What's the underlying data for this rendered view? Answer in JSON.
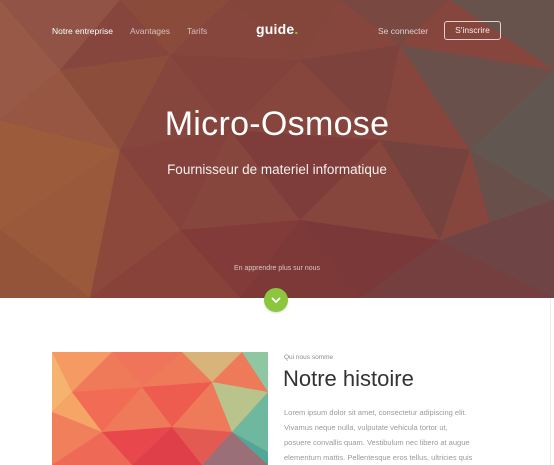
{
  "nav": {
    "links": [
      "Notre entreprise",
      "Avantages",
      "Tarifs"
    ],
    "brand": "guide",
    "brand_dot": ".",
    "login": "Se connecter",
    "signup": "S'inscrire"
  },
  "hero": {
    "title": "Micro-Osmose",
    "subtitle": "Fournisseur de materiel informatique",
    "more_link": "En apprendre plus sur nous",
    "scroll_icon": "chevron-down-icon"
  },
  "story": {
    "kicker": "Qui nous somme",
    "title": "Notre histoire",
    "body_lines": [
      "Lorem ipsum dolor sit amet, consectetur adipiscing elit.",
      "Vivamus neque nulla, vulputate vehicula tortor ut,",
      "posuere convallis quam. Vestibulum nec libero at augue",
      "elementum mattis. Pellentesque eros tellus, ultricies quis"
    ]
  },
  "colors": {
    "accent": "#8cc63f",
    "hero_base": "#8e4a40",
    "title_text": "#333333",
    "body_text": "#9a9a9a"
  }
}
